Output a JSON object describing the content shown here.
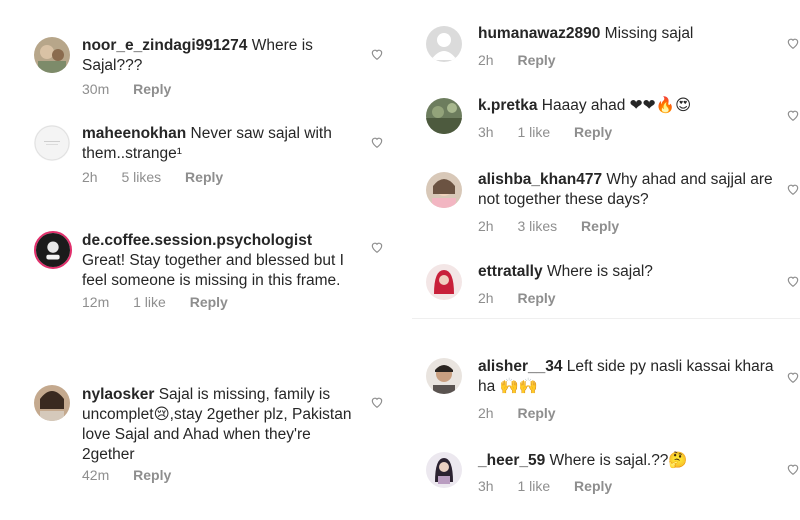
{
  "left_comments": [
    {
      "username": "noor_e_zindagi991274",
      "text": "Where is Sajal???",
      "time": "30m",
      "likes": "",
      "reply": "Reply"
    },
    {
      "username": "maheenokhan",
      "text": "Never saw sajal with them..strange¹",
      "time": "2h",
      "likes": "5 likes",
      "reply": "Reply"
    },
    {
      "username": "de.coffee.session.psychologist",
      "text": "Great! Stay together and blessed but I feel someone is missing in this frame.",
      "time": "12m",
      "likes": "1 like",
      "reply": "Reply"
    },
    {
      "username": "nylaosker",
      "text": "Sajal is missing, family is uncomplet😢,stay 2gether plz, Pakistan love Sajal and Ahad when they're 2gether",
      "time": "42m",
      "likes": "",
      "reply": "Reply"
    }
  ],
  "right_comments": [
    {
      "username": "humanawaz2890",
      "text": "Missing sajal",
      "time": "2h",
      "likes": "",
      "reply": "Reply"
    },
    {
      "username": "k.pretka",
      "text": "Haaay ahad ❤❤🔥😍",
      "time": "3h",
      "likes": "1 like",
      "reply": "Reply"
    },
    {
      "username": "alishba_khan477",
      "text": "Why ahad and sajjal are not together these days?",
      "time": "2h",
      "likes": "3 likes",
      "reply": "Reply"
    },
    {
      "username": "ettratally",
      "text": "Where is sajal?",
      "time": "2h",
      "likes": "",
      "reply": "Reply"
    },
    {
      "username": "alisher__34",
      "text": "Left side py nasli kassai khara ha 🙌🙌",
      "time": "2h",
      "likes": "",
      "reply": "Reply"
    },
    {
      "username": "_heer_59",
      "text": "Where is sajal.??🤔",
      "time": "3h",
      "likes": "1 like",
      "reply": "Reply"
    }
  ],
  "icons": {
    "like": "heart-outline-icon"
  },
  "colors": {
    "text": "#262626",
    "meta": "#8e8e8e",
    "background": "#ffffff"
  }
}
